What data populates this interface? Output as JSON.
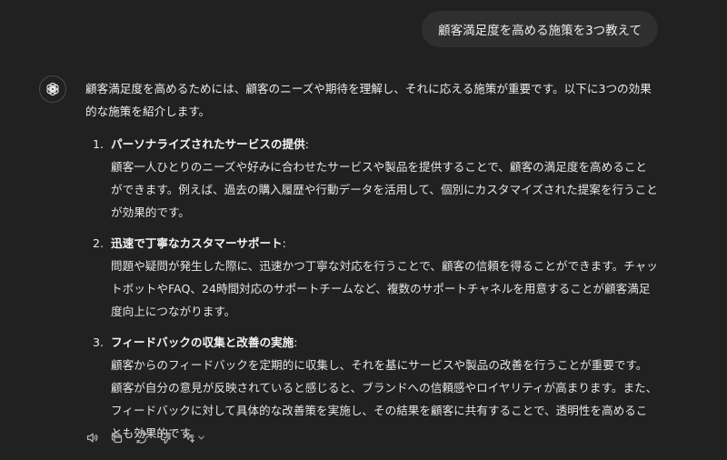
{
  "user_message": "顧客満足度を高める施策を3つ教えて",
  "answer": {
    "intro": "顧客満足度を高めるためには、顧客のニーズや期待を理解し、それに応える施策が重要です。以下に3つの効果的な施策を紹介します。",
    "items": [
      {
        "number": "1.",
        "title": "パーソナライズされたサービスの提供",
        "colon": ":",
        "description": "顧客一人ひとりのニーズや好みに合わせたサービスや製品を提供することで、顧客の満足度を高めることができます。例えば、過去の購入履歴や行動データを活用して、個別にカスタマイズされた提案を行うことが効果的です。"
      },
      {
        "number": "2.",
        "title": "迅速で丁寧なカスタマーサポート",
        "colon": ":",
        "description": "問題や疑問が発生した際に、迅速かつ丁寧な対応を行うことで、顧客の信頼を得ることができます。チャットボットやFAQ、24時間対応のサポートチームなど、複数のサポートチャネルを用意することが顧客満足度向上につながります。"
      },
      {
        "number": "3.",
        "title": "フィードバックの収集と改善の実施",
        "colon": ":",
        "description": "顧客からのフィードバックを定期的に収集し、それを基にサービスや製品の改善を行うことが重要です。顧客が自分の意見が反映されていると感じると、ブランドへの信頼感やロイヤリティが高まります。また、フィードバックに対して具体的な改善策を実施し、その結果を顧客に共有することで、透明性を高めることも効果的です。"
      }
    ]
  },
  "actions": [
    {
      "icon": "speaker-icon"
    },
    {
      "icon": "copy-icon"
    },
    {
      "icon": "regenerate-icon"
    },
    {
      "icon": "thumbs-down-icon"
    },
    {
      "icon": "sparkle-icon"
    }
  ],
  "colors": {
    "background": "#212121",
    "user_bubble": "#2f2f2f",
    "text": "#ececec",
    "icon": "#b4b4b4"
  }
}
